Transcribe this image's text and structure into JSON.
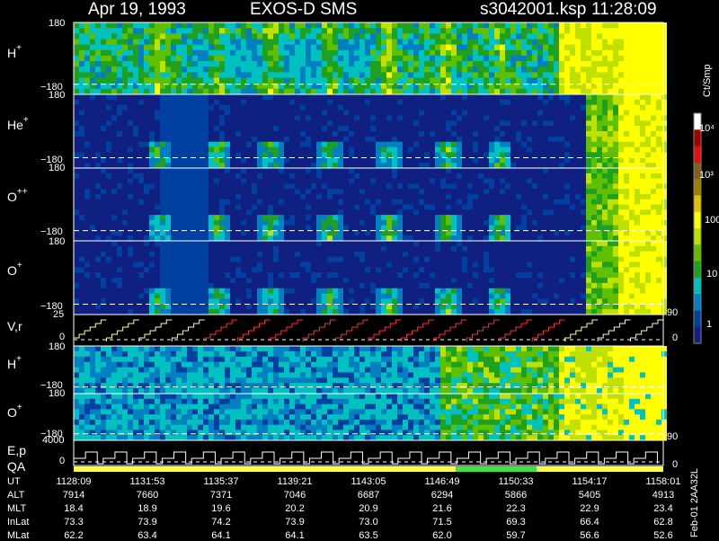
{
  "header": {
    "date": "Apr 19, 1993",
    "instrument": "EXOS-D SMS",
    "file": "s3042001.ksp",
    "time": "11:28:09"
  },
  "panels": {
    "h_plus_label": "H",
    "h_plus_sup": "+",
    "he_plus_label": "He",
    "he_plus_sup": "+",
    "o_pp_label": "O",
    "o_pp_sup": "++",
    "o_plus_label": "O",
    "o_plus_sup": "+",
    "vr_label": "V,r",
    "h_plus2_label": "H",
    "h_plus2_sup": "+",
    "o_plus2_label": "O",
    "o_plus2_sup": "+",
    "ep_label": "E,p",
    "qa_label": "QA"
  },
  "ticks": {
    "pos180": "180",
    "neg180": "−180",
    "v25": "25",
    "v0": "0",
    "r90": "90",
    "r0": "0",
    "e4000": "4000",
    "e0": "0",
    "e0r": "0"
  },
  "colorbar": {
    "unit": "Ct/Smp",
    "labels": [
      "10⁴",
      "10³",
      "100",
      "10",
      "1"
    ],
    "colors": [
      "#ffffff",
      "#a00000",
      "#e01010",
      "#806020",
      "#a08000",
      "#e0c000",
      "#ffff00",
      "#c0e000",
      "#60c000",
      "#20a020",
      "#00c0c0",
      "#0080c0",
      "#0040a0",
      "#102080"
    ]
  },
  "footer": {
    "row_labels": [
      "UT",
      "ALT",
      "MLT",
      "InLat",
      "MLat"
    ],
    "columns": [
      [
        "1128:09",
        "7914",
        "18.4",
        "73.3",
        "62.2"
      ],
      [
        "1131:53",
        "7660",
        "18.9",
        "73.9",
        "63.4"
      ],
      [
        "1135:37",
        "7371",
        "19.6",
        "74.2",
        "64.1"
      ],
      [
        "1139:21",
        "7046",
        "20.2",
        "73.9",
        "64.1"
      ],
      [
        "1143:05",
        "6687",
        "20.9",
        "73.0",
        "63.5"
      ],
      [
        "1146:49",
        "6294",
        "21.6",
        "71.5",
        "62.0"
      ],
      [
        "1150:33",
        "5866",
        "22.3",
        "69.3",
        "59.7"
      ],
      [
        "1154:17",
        "5405",
        "22.9",
        "66.4",
        "56.6"
      ],
      [
        "1158:01",
        "4913",
        "23.4",
        "62.8",
        "52.6"
      ]
    ],
    "side_id": "Feb-01 2AA32L"
  },
  "chart_data": {
    "type": "heatmap",
    "title": "Apr 19, 1993   EXOS-D SMS",
    "panels": [
      "H+",
      "He+",
      "O++",
      "O+",
      "V,r",
      "H+",
      "O+",
      "E,p",
      "QA"
    ],
    "x_tick_labels": [
      "1128:09",
      "1131:53",
      "1135:37",
      "1139:21",
      "1143:05",
      "1146:49",
      "1150:33",
      "1154:17",
      "1158:01"
    ],
    "y_range_angle": [
      -180,
      180
    ],
    "vr_range": [
      0,
      25
    ],
    "ep_range": [
      0,
      4000
    ],
    "right_axis_vr": [
      "90",
      "0"
    ],
    "right_axis_ep": [
      "90",
      "0"
    ],
    "colorbar_unit": "Ct/Smp",
    "colorbar_scale": "log",
    "colorbar_range": [
      1,
      10000
    ]
  }
}
